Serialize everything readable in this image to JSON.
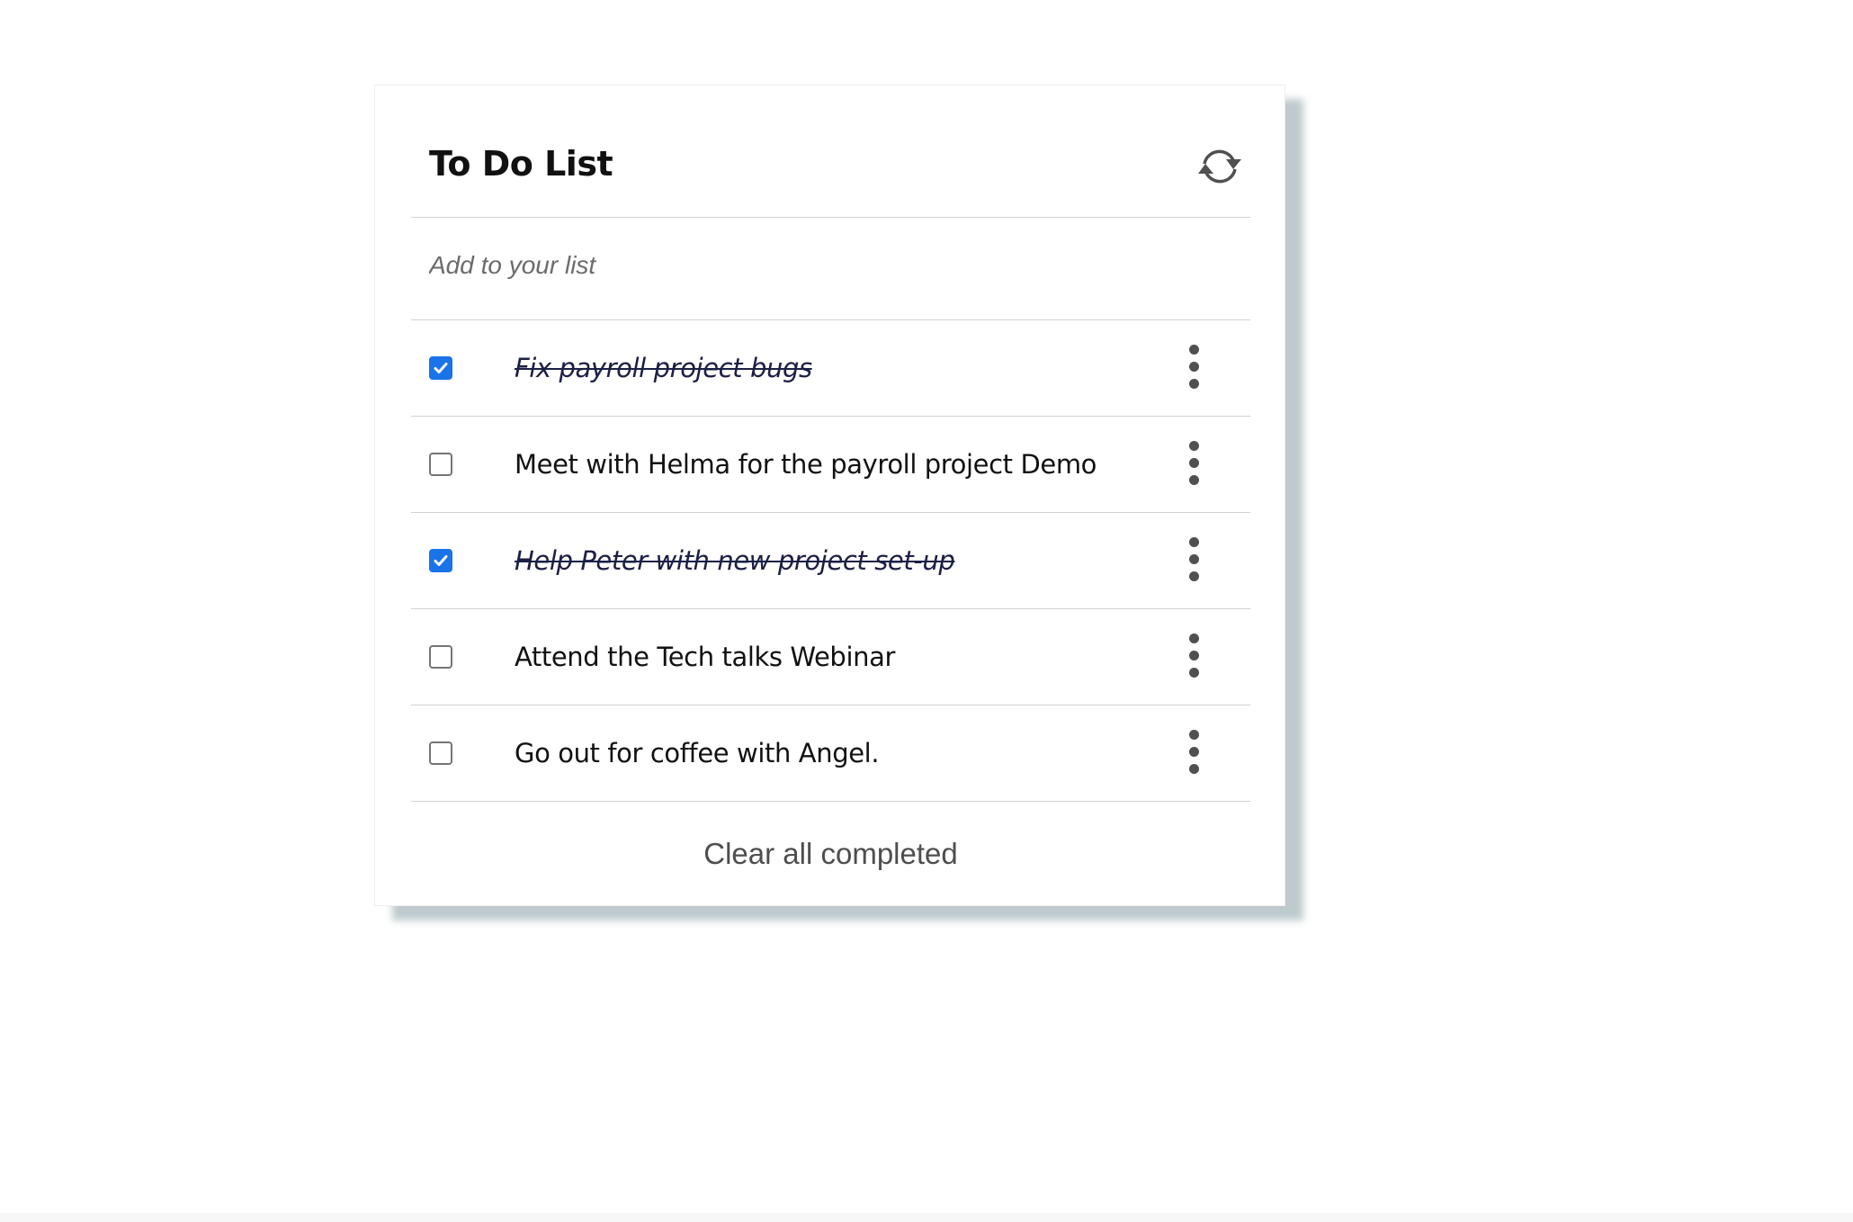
{
  "header": {
    "title": "To Do List",
    "refresh_icon": "refresh-icon"
  },
  "add_input": {
    "placeholder": "Add to your list",
    "value": ""
  },
  "todos": [
    {
      "label": "Fix payroll project bugs",
      "completed": true
    },
    {
      "label": "Meet with Helma for the payroll project Demo",
      "completed": false
    },
    {
      "label": "Help Peter with new project set-up",
      "completed": true
    },
    {
      "label": "Attend the Tech talks Webinar",
      "completed": false
    },
    {
      "label": "Go out for coffee with Angel.",
      "completed": false
    }
  ],
  "item_menu_icon": "more-vertical-icon",
  "footer": {
    "clear_label": "Clear all completed"
  },
  "colors": {
    "checkbox_checked": "#1a73e8",
    "completed_text": "#1c1f45",
    "card_shadow": "#a8b8bc"
  }
}
